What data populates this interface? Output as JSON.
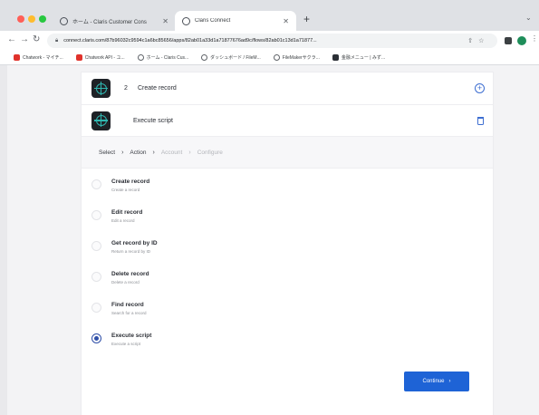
{
  "browser": {
    "tabs": [
      {
        "title": "ホーム - Claris Customer Cons",
        "active": false
      },
      {
        "title": "Claris Connect",
        "active": true
      }
    ],
    "url": "connect.claris.com/87b96032c9594c1a6bc85656/apps/82ab01a33d1a71877676ad9c/flows/82ab01c13d1a71877...",
    "bookmarks": [
      {
        "label": "Chatwork - マイチ..."
      },
      {
        "label": "Chatwork API - ユ..."
      },
      {
        "label": "ホーム - Claris Cus..."
      },
      {
        "label": "ダッシュボード / FileM..."
      },
      {
        "label": "FileMakerサクラ..."
      },
      {
        "label": "金融メニュー | みず..."
      }
    ]
  },
  "steps": [
    {
      "number": "2",
      "label": "Create record"
    },
    {
      "number": "",
      "label": "Execute script"
    }
  ],
  "breadcrumb": [
    "Select",
    "Action",
    "Account",
    "Configure"
  ],
  "options": [
    {
      "title": "Create record",
      "description": "Create a record",
      "checked": false
    },
    {
      "title": "Edit record",
      "description": "Edit a record",
      "checked": false
    },
    {
      "title": "Get record by ID",
      "description": "Return a record by ID",
      "checked": false
    },
    {
      "title": "Delete record",
      "description": "Delete a record",
      "checked": false
    },
    {
      "title": "Find record",
      "description": "Search for a record",
      "checked": false
    },
    {
      "title": "Execute script",
      "description": "Execute a script",
      "checked": true
    }
  ],
  "continue_label": "Continue",
  "colors": {
    "accent": "#1e63d6",
    "selected_radio": "#2f4fa8",
    "app_icon_bg": "#1e2126",
    "app_icon_ring": "#2fb6b0"
  }
}
